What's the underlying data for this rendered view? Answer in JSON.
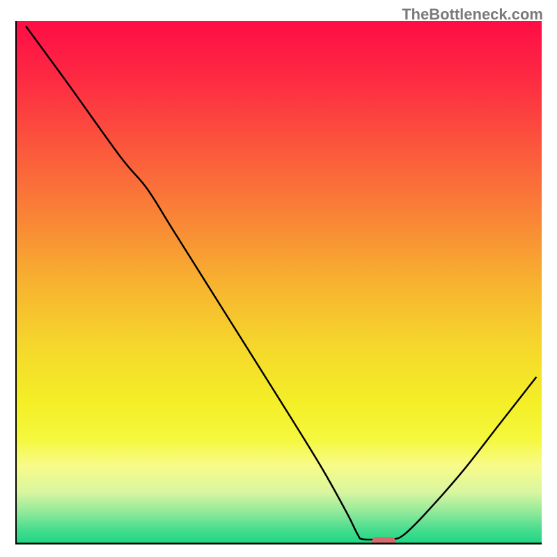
{
  "watermark": "TheBottleneck.com",
  "chart_data": {
    "type": "line",
    "title": "",
    "xlabel": "",
    "ylabel": "",
    "xlim": [
      0,
      100
    ],
    "ylim": [
      0,
      100
    ],
    "curve": [
      {
        "x": 2,
        "y": 99
      },
      {
        "x": 10,
        "y": 88
      },
      {
        "x": 20,
        "y": 74
      },
      {
        "x": 25,
        "y": 68
      },
      {
        "x": 30,
        "y": 60
      },
      {
        "x": 40,
        "y": 44
      },
      {
        "x": 50,
        "y": 28
      },
      {
        "x": 58,
        "y": 15
      },
      {
        "x": 63,
        "y": 6
      },
      {
        "x": 65,
        "y": 2
      },
      {
        "x": 66,
        "y": 1
      },
      {
        "x": 70,
        "y": 1
      },
      {
        "x": 72,
        "y": 1
      },
      {
        "x": 74,
        "y": 2
      },
      {
        "x": 78,
        "y": 6
      },
      {
        "x": 85,
        "y": 14
      },
      {
        "x": 92,
        "y": 23
      },
      {
        "x": 99,
        "y": 32
      }
    ],
    "marker": {
      "x": 70,
      "y": 0.6,
      "width": 4.5,
      "height": 1.6
    },
    "gradient_stops": [
      {
        "offset": 0,
        "color": "#fe0d45"
      },
      {
        "offset": 12,
        "color": "#fd2d42"
      },
      {
        "offset": 25,
        "color": "#fb5a3c"
      },
      {
        "offset": 38,
        "color": "#f98636"
      },
      {
        "offset": 50,
        "color": "#f7b230"
      },
      {
        "offset": 62,
        "color": "#f5d72b"
      },
      {
        "offset": 73,
        "color": "#f4ef27"
      },
      {
        "offset": 80,
        "color": "#f5f83e"
      },
      {
        "offset": 85,
        "color": "#f8fb89"
      },
      {
        "offset": 90,
        "color": "#d9f6a0"
      },
      {
        "offset": 94,
        "color": "#8ee99a"
      },
      {
        "offset": 97,
        "color": "#4bdd8f"
      },
      {
        "offset": 100,
        "color": "#18d683"
      }
    ]
  }
}
